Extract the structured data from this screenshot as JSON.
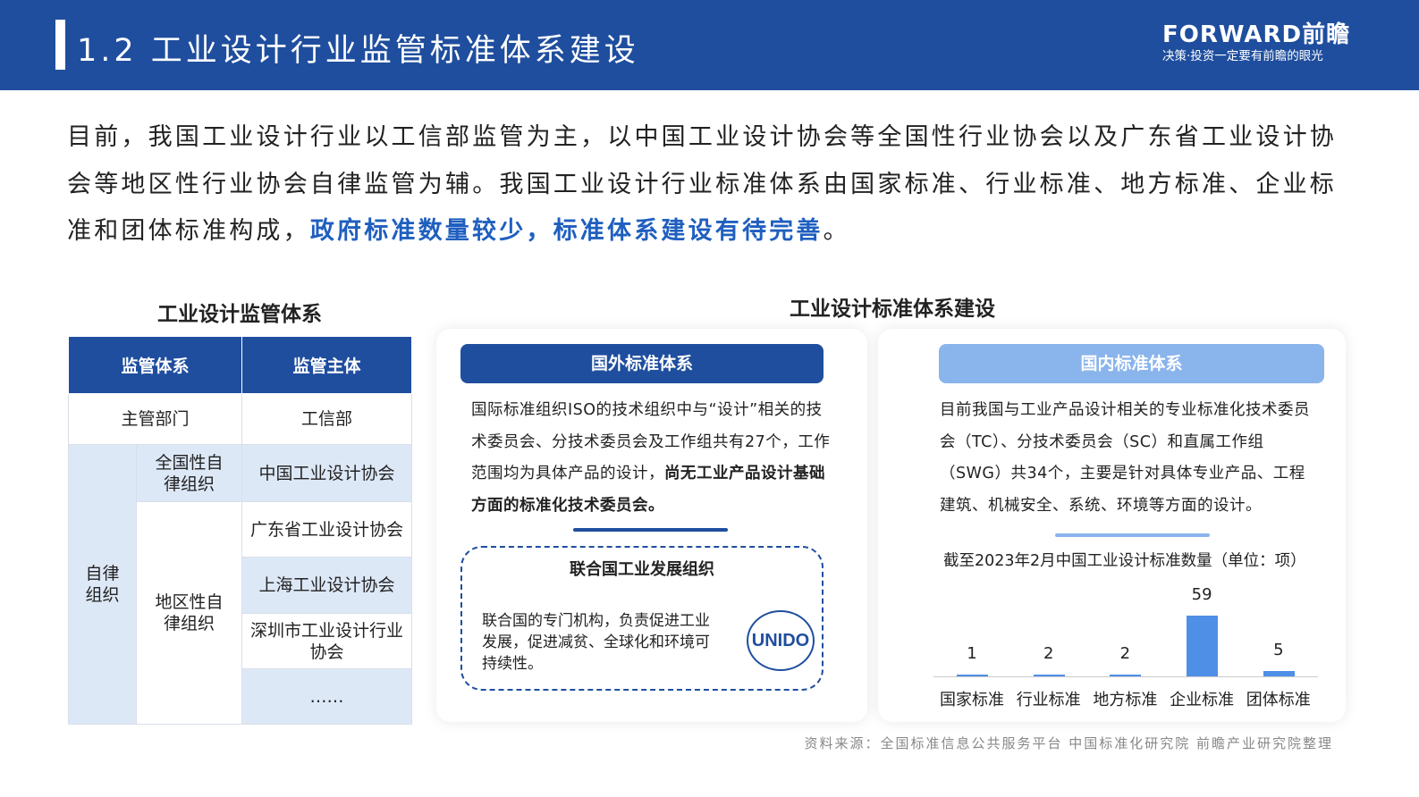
{
  "header": {
    "title": "1.2 工业设计行业监管标准体系建设",
    "logo_line1": "FORWARD前瞻",
    "logo_line2": "决策·投资一定要有前瞻的眼光"
  },
  "intro": {
    "text": "目前，我国工业设计行业以工信部监管为主，以中国工业设计协会等全国性行业协会以及广东省工业设计协会等地区性行业协会自律监管为辅。我国工业设计行业标准体系由国家标准、行业标准、地方标准、企业标准和团体标准构成，",
    "highlight": "政府标准数量较少，标准体系建设有待完善",
    "end": "。"
  },
  "left": {
    "title": "工业设计监管体系",
    "headers": [
      "监管体系",
      "监管主体"
    ],
    "row1": [
      "主管部门",
      "工信部"
    ],
    "self": "自律组织",
    "national": "全国性自律组织",
    "national_org": "中国工业设计协会",
    "regional": "地区性自律组织",
    "regional_orgs": [
      "广东省工业设计协会",
      "上海工业设计协会",
      "深圳市工业设计行业协会",
      "……"
    ]
  },
  "right": {
    "title": "工业设计标准体系建设",
    "foreign": {
      "label": "国外标准体系",
      "text": "国际标准组织ISO的技术组织中与“设计”相关的技术委员会、分技术委员会及工作组共有27个，工作范围均为具体产品的设计，",
      "bold": "尚无工业产品设计基础方面的标准化技术委员会。"
    },
    "unido": {
      "title": "联合国工业发展组织",
      "text": "联合国的专门机构，负责促进工业发展，促进减贫、全球化和环境可持续性。",
      "logo": "UNIDO"
    },
    "domestic": {
      "label": "国内标准体系",
      "text": "目前我国与工业产品设计相关的专业标准化技术委员会（TC）、分技术委员会（SC）和直属工作组（SWG）共34个，主要是针对具体专业产品、工程建筑、机械安全、系统、环境等方面的设计。"
    }
  },
  "chart_data": {
    "type": "bar",
    "title": "截至2023年2月中国工业设计标准数量（单位：项）",
    "categories": [
      "国家标准",
      "行业标准",
      "地方标准",
      "企业标准",
      "团体标准"
    ],
    "values": [
      1,
      2,
      2,
      59,
      5
    ],
    "color": "#4f8fe6"
  },
  "source": "资料来源：全国标准信息公共服务平台 中国标准化研究院 前瞻产业研究院整理"
}
